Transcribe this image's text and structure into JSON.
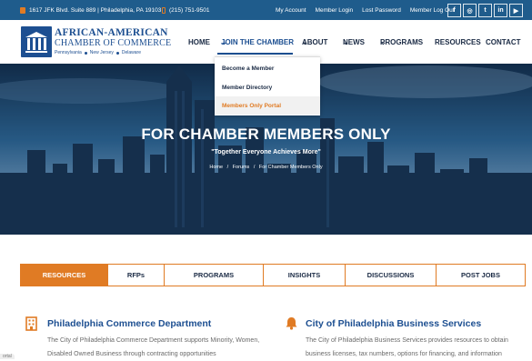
{
  "topbar": {
    "address": "1617 JFK Blvd. Suite 889 | Philadelphia, PA 19103",
    "phone": "(215) 751-9501",
    "links": [
      "My Account",
      "Member Login",
      "Lost Password",
      "Member Log Out"
    ],
    "socials": [
      {
        "icon": "facebook-icon",
        "glyph": "f"
      },
      {
        "icon": "instagram-icon",
        "glyph": "◎"
      },
      {
        "icon": "twitter-icon",
        "glyph": "t"
      },
      {
        "icon": "linkedin-icon",
        "glyph": "in"
      },
      {
        "icon": "youtube-icon",
        "glyph": "▶"
      }
    ]
  },
  "logo": {
    "line1": "AFRICAN-AMERICAN",
    "line2": "CHAMBER OF COMMERCE",
    "states": [
      "Pennsylvania",
      "New Jersey",
      "Delaware"
    ]
  },
  "nav": {
    "items": [
      {
        "label": "HOME"
      },
      {
        "label": "JOIN THE CHAMBER",
        "chevron": "⌄"
      },
      {
        "label": "ABOUT",
        "chevron": "⌄"
      },
      {
        "label": "NEWS",
        "chevron": "⌄"
      },
      {
        "label": "PROGRAMS",
        "chevron": "⌄"
      },
      {
        "label": "RESOURCES"
      },
      {
        "label": "CONTACT"
      }
    ]
  },
  "dropdown": {
    "items": [
      "Become a Member",
      "Member Directory",
      "Members Only Portal"
    ]
  },
  "hero": {
    "title": "FOR CHAMBER MEMBERS ONLY",
    "subtitle": "\"Together Everyone Achieves More\"",
    "breadcrumb": [
      "Home",
      "Forums",
      "For Chamber Members Only"
    ]
  },
  "tabs": [
    "RESOURCES",
    "RFPs",
    "PROGRAMS",
    "INSIGHTS",
    "DISCUSSIONS",
    "POST JOBS"
  ],
  "cards": [
    {
      "title": "Philadelphia Commerce Department",
      "text": "The City of Philadelphia Commerce Department supports Minority, Women, Disabled Owned Business through contracting opportunities"
    },
    {
      "title": "City of Philadelphia Business Services",
      "text": "The City of Philadelphia Business Services provides resources to obtain business licenses, tax numbers, options for financing, and information"
    }
  ],
  "corner_label": "ortal",
  "colors": {
    "brand_blue": "#1d4f91",
    "topbar_blue": "#1f5c8c",
    "accent_orange": "#e07b24"
  }
}
